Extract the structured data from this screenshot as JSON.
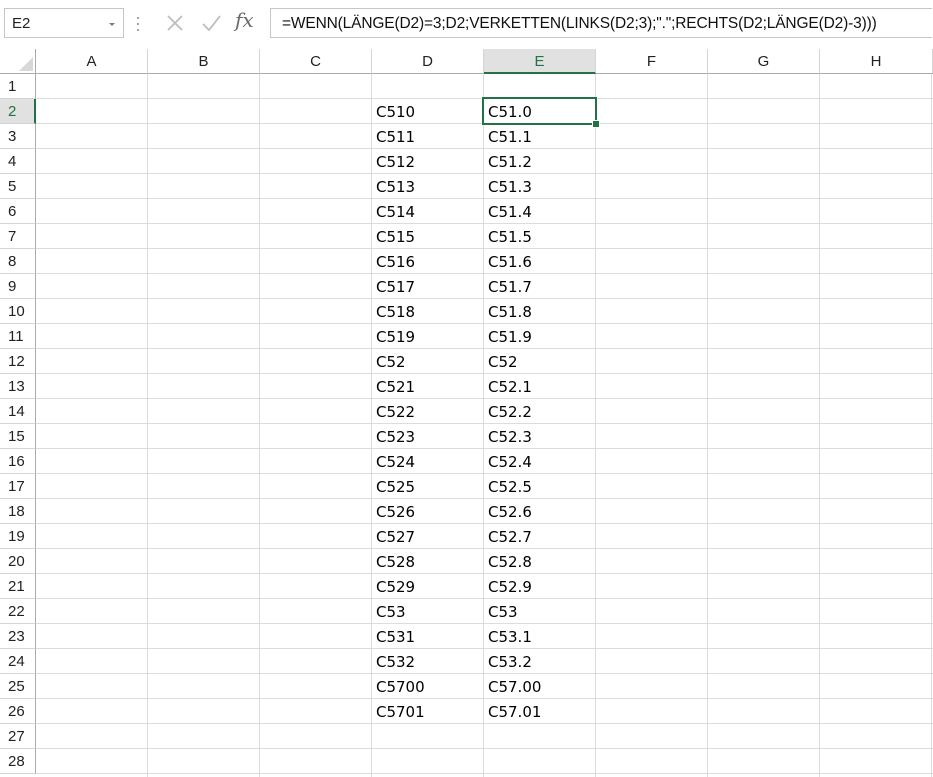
{
  "formula_bar": {
    "name_box": "E2",
    "cancel_icon": "x-icon",
    "enter_icon": "check-icon",
    "fx_label": "fx",
    "formula": "=WENN(LÄNGE(D2)=3;D2;VERKETTEN(LINKS(D2;3);\".\";RECHTS(D2;LÄNGE(D2)-3)))"
  },
  "sheet": {
    "columns": [
      "A",
      "B",
      "C",
      "D",
      "E",
      "F",
      "G",
      "H"
    ],
    "selected_column": "E",
    "rows": [
      "1",
      "2",
      "3",
      "4",
      "5",
      "6",
      "7",
      "8",
      "9",
      "10",
      "11",
      "12",
      "13",
      "14",
      "15",
      "16",
      "17",
      "18",
      "19",
      "20",
      "21",
      "22",
      "23",
      "24",
      "25",
      "26",
      "27",
      "28"
    ],
    "selected_row": "2",
    "active_cell": "E2",
    "data_rows": [
      {
        "row": "2",
        "D": "C510",
        "E": "C51.0"
      },
      {
        "row": "3",
        "D": "C511",
        "E": "C51.1"
      },
      {
        "row": "4",
        "D": "C512",
        "E": "C51.2"
      },
      {
        "row": "5",
        "D": "C513",
        "E": "C51.3"
      },
      {
        "row": "6",
        "D": "C514",
        "E": "C51.4"
      },
      {
        "row": "7",
        "D": "C515",
        "E": "C51.5"
      },
      {
        "row": "8",
        "D": "C516",
        "E": "C51.6"
      },
      {
        "row": "9",
        "D": "C517",
        "E": "C51.7"
      },
      {
        "row": "10",
        "D": "C518",
        "E": "C51.8"
      },
      {
        "row": "11",
        "D": "C519",
        "E": "C51.9"
      },
      {
        "row": "12",
        "D": "C52",
        "E": "C52"
      },
      {
        "row": "13",
        "D": "C521",
        "E": "C52.1"
      },
      {
        "row": "14",
        "D": "C522",
        "E": "C52.2"
      },
      {
        "row": "15",
        "D": "C523",
        "E": "C52.3"
      },
      {
        "row": "16",
        "D": "C524",
        "E": "C52.4"
      },
      {
        "row": "17",
        "D": "C525",
        "E": "C52.5"
      },
      {
        "row": "18",
        "D": "C526",
        "E": "C52.6"
      },
      {
        "row": "19",
        "D": "C527",
        "E": "C52.7"
      },
      {
        "row": "20",
        "D": "C528",
        "E": "C52.8"
      },
      {
        "row": "21",
        "D": "C529",
        "E": "C52.9"
      },
      {
        "row": "22",
        "D": "C53",
        "E": "C53"
      },
      {
        "row": "23",
        "D": "C531",
        "E": "C53.1"
      },
      {
        "row": "24",
        "D": "C532",
        "E": "C53.2"
      },
      {
        "row": "25",
        "D": "C5700",
        "E": "C57.00"
      },
      {
        "row": "26",
        "D": "C5701",
        "E": "C57.01"
      }
    ]
  },
  "colors": {
    "accent": "#217346",
    "gridline": "#dadcdd",
    "header_selected_bg": "#e1e1e1"
  }
}
